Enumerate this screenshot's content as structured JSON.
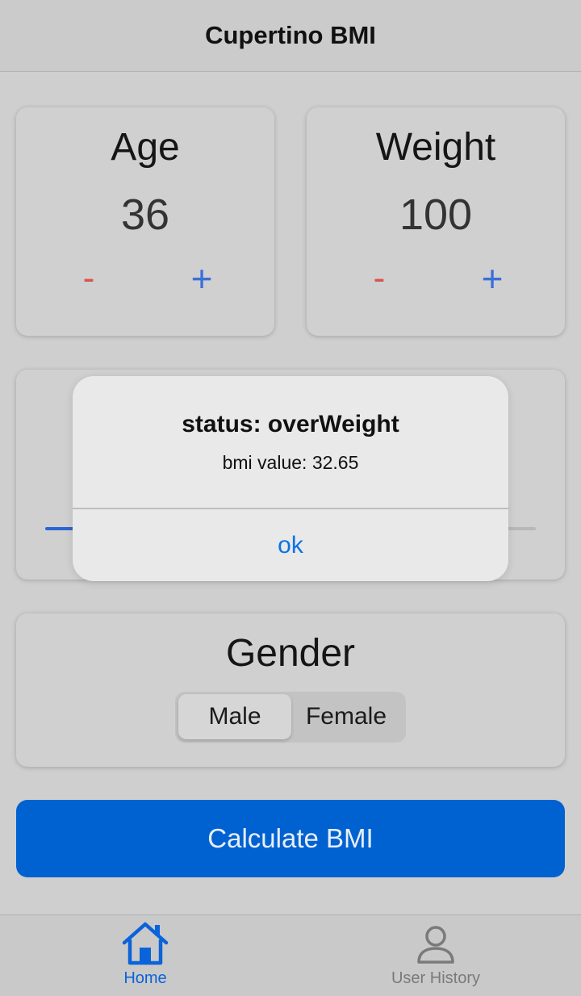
{
  "app": {
    "title": "Cupertino BMI"
  },
  "age_card": {
    "label": "Age",
    "value": "36",
    "decrement_label": "-",
    "increment_label": "+"
  },
  "weight_card": {
    "label": "Weight",
    "value": "100",
    "decrement_label": "-",
    "increment_label": "+"
  },
  "gender_card": {
    "label": "Gender",
    "options": [
      "Male",
      "Female"
    ],
    "selected": "Male"
  },
  "calculate_button": {
    "label": "Calculate BMI"
  },
  "tab_bar": {
    "items": [
      {
        "label": "Home",
        "icon": "home-icon",
        "active": true
      },
      {
        "label": "User History",
        "icon": "person-icon",
        "active": false
      }
    ]
  },
  "alert": {
    "title": "status: overWeight",
    "message": "bmi value: 32.65",
    "action_label": "ok"
  },
  "colors": {
    "accent": "#0062d0",
    "decrement": "#d9534f",
    "increment": "#3a6fd8",
    "active_tab": "#0a63d8",
    "inactive_tab": "#7a7a7a",
    "alert_action": "#0a72e6"
  }
}
